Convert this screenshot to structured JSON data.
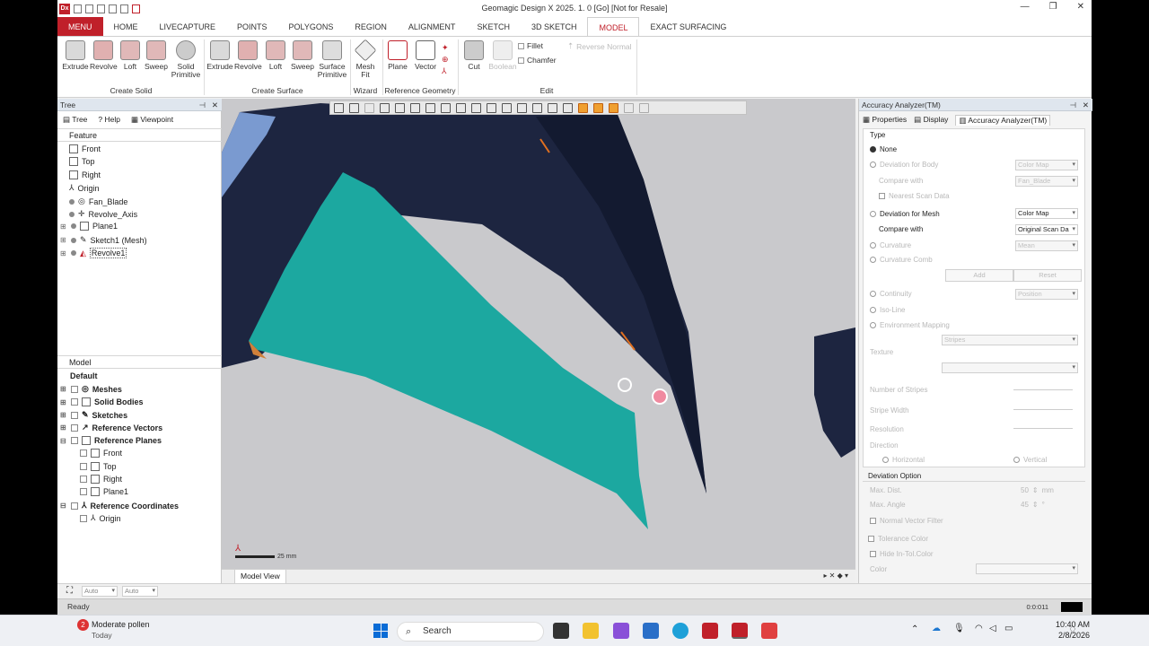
{
  "window": {
    "title": "Geomagic Design X 2025. 1. 0 [Go] [Not for Resale]",
    "logo": "Dx"
  },
  "ribbon": {
    "tabs": [
      "MENU",
      "HOME",
      "LIVECAPTURE",
      "POINTS",
      "POLYGONS",
      "REGION",
      "ALIGNMENT",
      "SKETCH",
      "3D SKETCH",
      "MODEL",
      "EXACT SURFACING"
    ],
    "active_tab": "MODEL",
    "create_solid": {
      "label": "Create Solid",
      "buttons": [
        "Extrude",
        "Revolve",
        "Loft",
        "Sweep",
        "Solid Primitive"
      ]
    },
    "create_surface": {
      "label": "Create Surface",
      "buttons": [
        "Extrude",
        "Revolve",
        "Loft",
        "Sweep",
        "Surface Primitive"
      ]
    },
    "wizard": {
      "label": "Wizard",
      "buttons": [
        "Mesh Fit"
      ]
    },
    "reference_geometry": {
      "label": "Reference Geometry",
      "buttons": [
        "Plane",
        "Vector"
      ]
    },
    "edit": {
      "label": "Edit",
      "buttons": [
        "Cut",
        "Boolean"
      ],
      "small": [
        "Fillet",
        "Chamfer",
        "Reverse Normal"
      ]
    }
  },
  "tree_panel": {
    "title": "Tree",
    "subtabs": [
      "Tree",
      "Help",
      "Viewpoint"
    ],
    "feature_header": "Feature",
    "features": [
      "Front",
      "Top",
      "Right",
      "Origin",
      "Fan_Blade",
      "Revolve_Axis",
      "Plane1",
      "Sketch1 (Mesh)",
      "Revolve1"
    ],
    "model_header": "Model",
    "model_root": "Default",
    "model_items": [
      "Meshes",
      "Solid Bodies",
      "Sketches",
      "Reference Vectors",
      "Reference Planes"
    ],
    "plane_children": [
      "Front",
      "Top",
      "Right",
      "Plane1"
    ],
    "coords": "Reference Coordinates",
    "coord_children": [
      "Origin"
    ]
  },
  "viewport": {
    "tab": "Model View",
    "scale_label": "25 mm"
  },
  "right_panel": {
    "title": "Accuracy Analyzer(TM)",
    "tabs": [
      "Properties",
      "Display",
      "Accuracy Analyzer(TM)"
    ],
    "type_label": "Type",
    "none_label": "None",
    "deviation_body": "Deviation for Body",
    "color_map_dis": "Color Map",
    "compare_with": "Compare with",
    "fan_blade": "Fan_Blade",
    "nearest": "Nearest Scan Data",
    "deviation_mesh": "Deviation for Mesh",
    "color_map": "Color Map",
    "original_scan": "Original Scan Da",
    "curvature": "Curvature",
    "mean": "Mean",
    "curvature_comb": "Curvature Comb",
    "add": "Add",
    "reset": "Reset",
    "continuity": "Continuity",
    "position": "Position",
    "iso_line": "Iso-Line",
    "env_mapping": "Environment Mapping",
    "stripes": "Stripes",
    "texture": "Texture",
    "num_stripes": "Number of Stripes",
    "stripe_width": "Stripe Width",
    "resolution": "Resolution",
    "direction": "Direction",
    "horizontal": "Horizontal",
    "vertical": "Vertical",
    "deviation_option": "Deviation Option",
    "max_dist": "Max. Dist.",
    "max_dist_val": "50",
    "mm": "mm",
    "max_angle": "Max. Angle",
    "max_angle_val": "45",
    "deg": "°",
    "normal_filter": "Normal Vector Filter",
    "tolerance_color": "Tolerance Color",
    "hide_in_tol": "Hide In-Tol.Color",
    "color": "Color"
  },
  "snap_bar": {
    "auto1": "Auto",
    "auto2": "Auto"
  },
  "status": {
    "text": "Ready",
    "right": "0:0:011"
  },
  "taskbar": {
    "weather_title": "Moderate pollen",
    "weather_sub": "Today",
    "badge": "2",
    "search": "Search",
    "time": "10:40 AM",
    "date": "2/8/2026"
  }
}
